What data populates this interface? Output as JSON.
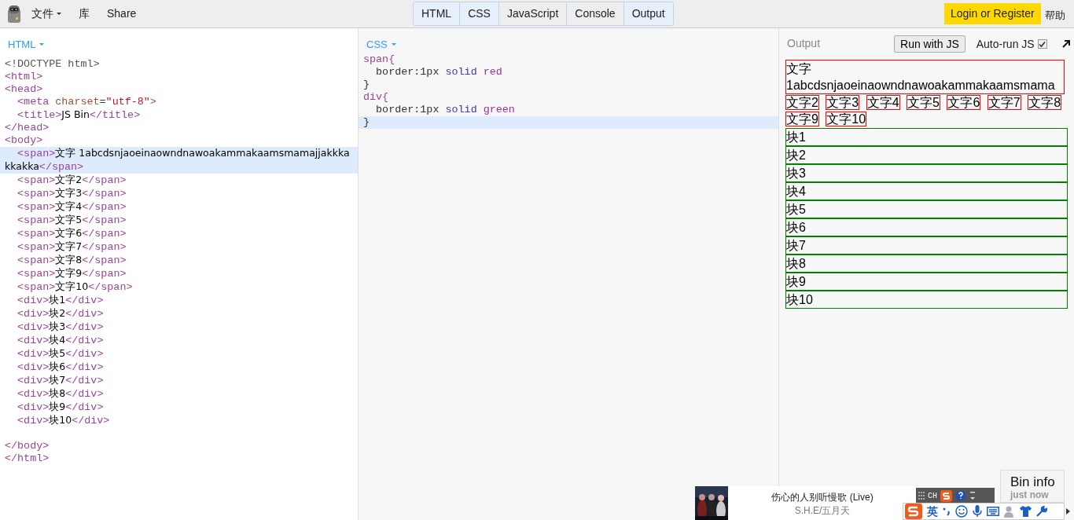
{
  "menu": {
    "items": [
      {
        "label": "文件",
        "dropdown": true
      },
      {
        "label": "库",
        "dropdown": false
      },
      {
        "label": "Share",
        "dropdown": false
      }
    ]
  },
  "panel_tabs": [
    {
      "label": "HTML",
      "selected": true
    },
    {
      "label": "CSS",
      "selected": true
    },
    {
      "label": "JavaScript",
      "selected": false
    },
    {
      "label": "Console",
      "selected": false
    },
    {
      "label": "Output",
      "selected": true
    }
  ],
  "login_button": "Login or Register",
  "help": "帮助",
  "html_panel": {
    "title": "HTML",
    "lines": [
      {
        "tokens": [
          {
            "kind": "meta",
            "text": "<!DOCTYPE html>"
          }
        ],
        "active": false
      },
      {
        "tokens": [
          {
            "kind": "tag",
            "text": "<html>"
          }
        ],
        "active": false
      },
      {
        "tokens": [
          {
            "kind": "tag",
            "text": "<head>"
          }
        ],
        "active": false
      },
      {
        "tokens": [
          {
            "kind": "tag",
            "text": "  <meta "
          },
          {
            "kind": "attr",
            "text": "charset"
          },
          {
            "kind": "punct",
            "text": "="
          },
          {
            "kind": "str",
            "text": "\"utf-8\""
          },
          {
            "kind": "tag",
            "text": ">"
          }
        ],
        "active": false
      },
      {
        "tokens": [
          {
            "kind": "tag",
            "text": "  <title>"
          },
          {
            "kind": "text",
            "text": "JS Bin"
          },
          {
            "kind": "tag",
            "text": "</title>"
          }
        ],
        "active": false
      },
      {
        "tokens": [
          {
            "kind": "tag",
            "text": "</head>"
          }
        ],
        "active": false
      },
      {
        "tokens": [
          {
            "kind": "tag",
            "text": "<body>"
          }
        ],
        "active": false
      },
      {
        "tokens": [
          {
            "kind": "tag",
            "text": "  <span>"
          },
          {
            "kind": "text",
            "text": "文字 1abcdsnjaoeinaowndnawoakammakaamsmamajjakkkakkakka"
          },
          {
            "kind": "tag",
            "text": "</span>"
          }
        ],
        "active": true
      },
      {
        "tokens": [
          {
            "kind": "tag",
            "text": "  <span>"
          },
          {
            "kind": "text",
            "text": "文字2"
          },
          {
            "kind": "tag",
            "text": "</span>"
          }
        ],
        "active": false
      },
      {
        "tokens": [
          {
            "kind": "tag",
            "text": "  <span>"
          },
          {
            "kind": "text",
            "text": "文字3"
          },
          {
            "kind": "tag",
            "text": "</span>"
          }
        ],
        "active": false
      },
      {
        "tokens": [
          {
            "kind": "tag",
            "text": "  <span>"
          },
          {
            "kind": "text",
            "text": "文字4"
          },
          {
            "kind": "tag",
            "text": "</span>"
          }
        ],
        "active": false
      },
      {
        "tokens": [
          {
            "kind": "tag",
            "text": "  <span>"
          },
          {
            "kind": "text",
            "text": "文字5"
          },
          {
            "kind": "tag",
            "text": "</span>"
          }
        ],
        "active": false
      },
      {
        "tokens": [
          {
            "kind": "tag",
            "text": "  <span>"
          },
          {
            "kind": "text",
            "text": "文字6"
          },
          {
            "kind": "tag",
            "text": "</span>"
          }
        ],
        "active": false
      },
      {
        "tokens": [
          {
            "kind": "tag",
            "text": "  <span>"
          },
          {
            "kind": "text",
            "text": "文字7"
          },
          {
            "kind": "tag",
            "text": "</span>"
          }
        ],
        "active": false
      },
      {
        "tokens": [
          {
            "kind": "tag",
            "text": "  <span>"
          },
          {
            "kind": "text",
            "text": "文字8"
          },
          {
            "kind": "tag",
            "text": "</span>"
          }
        ],
        "active": false
      },
      {
        "tokens": [
          {
            "kind": "tag",
            "text": "  <span>"
          },
          {
            "kind": "text",
            "text": "文字9"
          },
          {
            "kind": "tag",
            "text": "</span>"
          }
        ],
        "active": false
      },
      {
        "tokens": [
          {
            "kind": "tag",
            "text": "  <span>"
          },
          {
            "kind": "text",
            "text": "文字10"
          },
          {
            "kind": "tag",
            "text": "</span>"
          }
        ],
        "active": false
      },
      {
        "tokens": [
          {
            "kind": "tag",
            "text": "  <div>"
          },
          {
            "kind": "text",
            "text": "块1"
          },
          {
            "kind": "tag",
            "text": "</div>"
          }
        ],
        "active": false
      },
      {
        "tokens": [
          {
            "kind": "tag",
            "text": "  <div>"
          },
          {
            "kind": "text",
            "text": "块2"
          },
          {
            "kind": "tag",
            "text": "</div>"
          }
        ],
        "active": false
      },
      {
        "tokens": [
          {
            "kind": "tag",
            "text": "  <div>"
          },
          {
            "kind": "text",
            "text": "块3"
          },
          {
            "kind": "tag",
            "text": "</div>"
          }
        ],
        "active": false
      },
      {
        "tokens": [
          {
            "kind": "tag",
            "text": "  <div>"
          },
          {
            "kind": "text",
            "text": "块4"
          },
          {
            "kind": "tag",
            "text": "</div>"
          }
        ],
        "active": false
      },
      {
        "tokens": [
          {
            "kind": "tag",
            "text": "  <div>"
          },
          {
            "kind": "text",
            "text": "块5"
          },
          {
            "kind": "tag",
            "text": "</div>"
          }
        ],
        "active": false
      },
      {
        "tokens": [
          {
            "kind": "tag",
            "text": "  <div>"
          },
          {
            "kind": "text",
            "text": "块6"
          },
          {
            "kind": "tag",
            "text": "</div>"
          }
        ],
        "active": false
      },
      {
        "tokens": [
          {
            "kind": "tag",
            "text": "  <div>"
          },
          {
            "kind": "text",
            "text": "块7"
          },
          {
            "kind": "tag",
            "text": "</div>"
          }
        ],
        "active": false
      },
      {
        "tokens": [
          {
            "kind": "tag",
            "text": "  <div>"
          },
          {
            "kind": "text",
            "text": "块8"
          },
          {
            "kind": "tag",
            "text": "</div>"
          }
        ],
        "active": false
      },
      {
        "tokens": [
          {
            "kind": "tag",
            "text": "  <div>"
          },
          {
            "kind": "text",
            "text": "块9"
          },
          {
            "kind": "tag",
            "text": "</div>"
          }
        ],
        "active": false
      },
      {
        "tokens": [
          {
            "kind": "tag",
            "text": "  <div>"
          },
          {
            "kind": "text",
            "text": "块10"
          },
          {
            "kind": "tag",
            "text": "</div>"
          }
        ],
        "active": false
      },
      {
        "tokens": [
          {
            "kind": "tag",
            "text": "</body>"
          }
        ],
        "active": false,
        "gap_before": true
      },
      {
        "tokens": [
          {
            "kind": "tag",
            "text": "</html>"
          }
        ],
        "active": false
      }
    ]
  },
  "css_panel": {
    "title": "CSS",
    "lines": [
      {
        "tokens": [
          {
            "kind": "tag",
            "text": "span{"
          }
        ],
        "active": false
      },
      {
        "tokens": [
          {
            "kind": "prop",
            "text": "  border:1px "
          },
          {
            "kind": "kw",
            "text": "solid "
          },
          {
            "kind": "val",
            "text": "red"
          }
        ],
        "active": false
      },
      {
        "tokens": [
          {
            "kind": "prop",
            "text": "}"
          }
        ],
        "active": false
      },
      {
        "tokens": [
          {
            "kind": "tag",
            "text": "div{"
          }
        ],
        "active": false
      },
      {
        "tokens": [
          {
            "kind": "prop",
            "text": "  border:1px "
          },
          {
            "kind": "kw",
            "text": "solid "
          },
          {
            "kind": "val",
            "text": "green"
          }
        ],
        "active": false
      },
      {
        "tokens": [
          {
            "kind": "prop",
            "text": "}"
          }
        ],
        "active": true
      }
    ]
  },
  "output_panel": {
    "title": "Output",
    "run_button": "Run with JS",
    "auto_run": {
      "label": "Auto-run JS",
      "checked": true
    },
    "spans": [
      "文字 1abcdsnjaoeinaowndnawoakammakaamsmama",
      "文字2",
      "文字3",
      "文字4",
      "文字5",
      "文字6",
      "文字7",
      "文字8",
      "文字9",
      "文字10"
    ],
    "blocks": [
      "块1",
      "块2",
      "块3",
      "块4",
      "块5",
      "块6",
      "块7",
      "块8",
      "块9",
      "块10"
    ]
  },
  "music_popup": {
    "title": "伤心的人别听慢歌 (Live)",
    "artist": "S.H.E/五月天"
  },
  "ime_toolbar": {
    "mode": "CH",
    "language": "英"
  },
  "bin_info": {
    "title": "Bin info",
    "time": "just now"
  }
}
